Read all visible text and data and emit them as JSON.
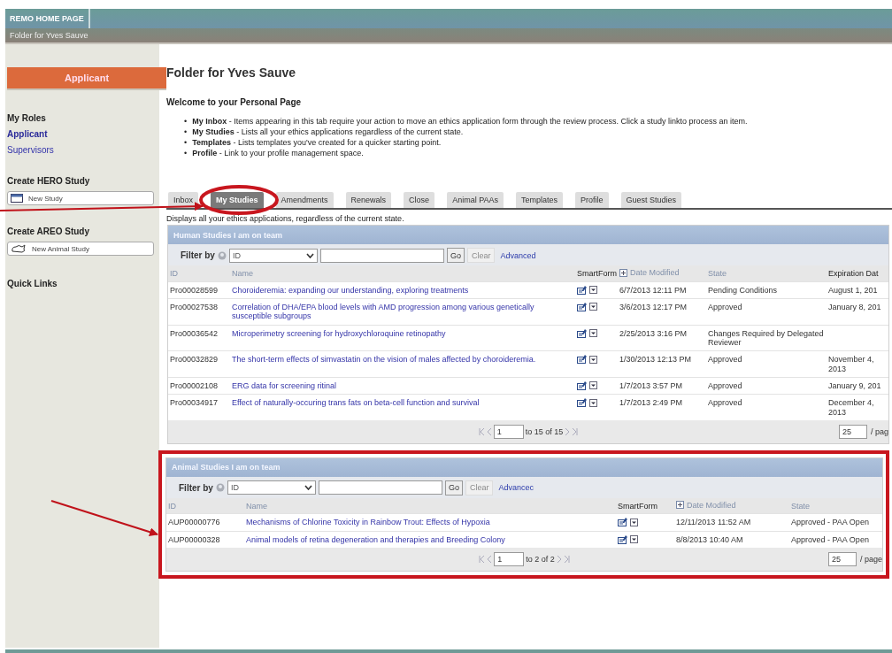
{
  "header": {
    "title": "REMO HOME PAGE",
    "subtitle": "Folder for Yves Sauve"
  },
  "sidebar": {
    "role_button": "Applicant",
    "roles_heading": "My Roles",
    "roles": [
      {
        "label": "Applicant",
        "selected": true
      },
      {
        "label": "Supervisors",
        "selected": false
      }
    ],
    "create": [
      {
        "heading": "Create HERO Study",
        "button": "New Study",
        "kind": "calendar"
      },
      {
        "heading": "Create AREO Study",
        "button": "New Animal Study",
        "kind": "animal"
      }
    ],
    "quick_links": "Quick Links"
  },
  "main": {
    "title": "Folder for Yves Sauve",
    "welcome": "Welcome to your Personal Page",
    "bullets": [
      {
        "marker": "•",
        "text": "**My Inbox**  - Items appearing in this tab require your action to move an ethics application form through the review process.  Click a study linkto process an item."
      },
      {
        "marker": "•",
        "text": "**My Studies** - Lists all your ethics applications regardless of the current state."
      },
      {
        "marker": "•",
        "text": "**Templates** - Lists templates you've created for a quicker starting point."
      },
      {
        "marker": "•",
        "text": "**Profile** - Link to your profile management space."
      }
    ],
    "tabs": [
      {
        "label": "Inbox",
        "selected": false
      },
      {
        "label": "My Studies",
        "selected": true
      },
      {
        "label": "Amendments",
        "selected": false
      },
      {
        "label": "Renewals",
        "selected": false
      },
      {
        "label": "Close",
        "selected": false
      },
      {
        "label": "Animal PAAs",
        "selected": false
      },
      {
        "label": "Templates",
        "selected": false
      },
      {
        "label": "Profile",
        "selected": false
      },
      {
        "label": "Guest Studies",
        "selected": false
      }
    ],
    "tab_description": "Displays all your ethics applications, regardless of the current state."
  },
  "panels": [
    {
      "title": "Human Studies I am on team",
      "highlighted": false,
      "filter": {
        "label": "Filter by",
        "field": "ID",
        "go": "Go",
        "clear": {
          "label": "Clear",
          "disabled": true
        },
        "advanced": "Advanced"
      },
      "columns": [
        {
          "label": "ID",
          "kind": "field"
        },
        {
          "label": "Name",
          "kind": "field"
        },
        {
          "label": "SmartForm",
          "kind": "plain"
        },
        {
          "label": "Date Modified",
          "kind": "sorted"
        },
        {
          "label": "State",
          "kind": "field"
        },
        {
          "label": "Expiration Dat",
          "kind": "plain"
        }
      ],
      "rows": [
        {
          "id": "Pro00028599",
          "name": "Choroideremia: expanding our understanding, exploring treatments",
          "modified": "6/7/2013 12:11 PM",
          "state": "Pending Conditions",
          "expiration": "August 1, 201"
        },
        {
          "id": "Pro00027538",
          "name": "Correlation of DHA/EPA blood levels with AMD progression among various genetically susceptible subgroups",
          "modified": "3/6/2013 12:17 PM",
          "state": "Approved",
          "expiration": "January 8, 201"
        },
        {
          "id": "Pro00036542",
          "name": "Microperimetry screening for hydroxychloroquine retinopathy",
          "modified": "2/25/2013 3:16 PM",
          "state": "Changes Required by Delegated Reviewer"
        },
        {
          "id": "Pro00032829",
          "name": "The short-term effects of simvastatin on the vision of males affected by choroideremia.",
          "modified": "1/30/2013 12:13 PM",
          "state": "Approved",
          "expiration": "November 4, 2013"
        },
        {
          "id": "Pro00002108",
          "name": "ERG data for screening ritinal",
          "modified": "1/7/2013 3:57 PM",
          "state": "Approved",
          "expiration": "January 9, 201"
        },
        {
          "id": "Pro00034917",
          "name": "Effect of naturally-occuring trans fats on beta-cell function and survival",
          "modified": "1/7/2013 2:49 PM",
          "state": "Approved",
          "expiration": "December 4, 2013"
        }
      ],
      "pager": {
        "page": "1",
        "range": "to 15 of 15",
        "per_page": "25",
        "per_page_label": "/ pag"
      }
    },
    {
      "title": "Animal Studies I am on team",
      "highlighted": true,
      "filter": {
        "label": "Filter by",
        "field": "ID",
        "go": "Go",
        "clear": {
          "label": "Clear",
          "disabled": true
        },
        "advanced": "Advancec"
      },
      "columns": [
        {
          "label": "ID",
          "kind": "field"
        },
        {
          "label": "Name",
          "kind": "field"
        },
        {
          "label": "SmartForm",
          "kind": "plain"
        },
        {
          "label": "Date Modified",
          "kind": "sorted"
        },
        {
          "label": "State",
          "kind": "field"
        }
      ],
      "rows": [
        {
          "id": "AUP00000776",
          "name": "Mechanisms of Chlorine Toxicity in Rainbow Trout: Effects of Hypoxia",
          "modified": "12/11/2013 11:52 AM",
          "state": "Approved - PAA Open"
        },
        {
          "id": "AUP00000328",
          "name": "Animal models of retina degeneration and therapies and Breeding Colony",
          "modified": "8/8/2013 10:40 AM",
          "state": "Approved - PAA Open"
        }
      ],
      "pager": {
        "page": "1",
        "range": "to 2 of 2",
        "per_page": "25",
        "per_page_label": "/ page"
      }
    }
  ]
}
